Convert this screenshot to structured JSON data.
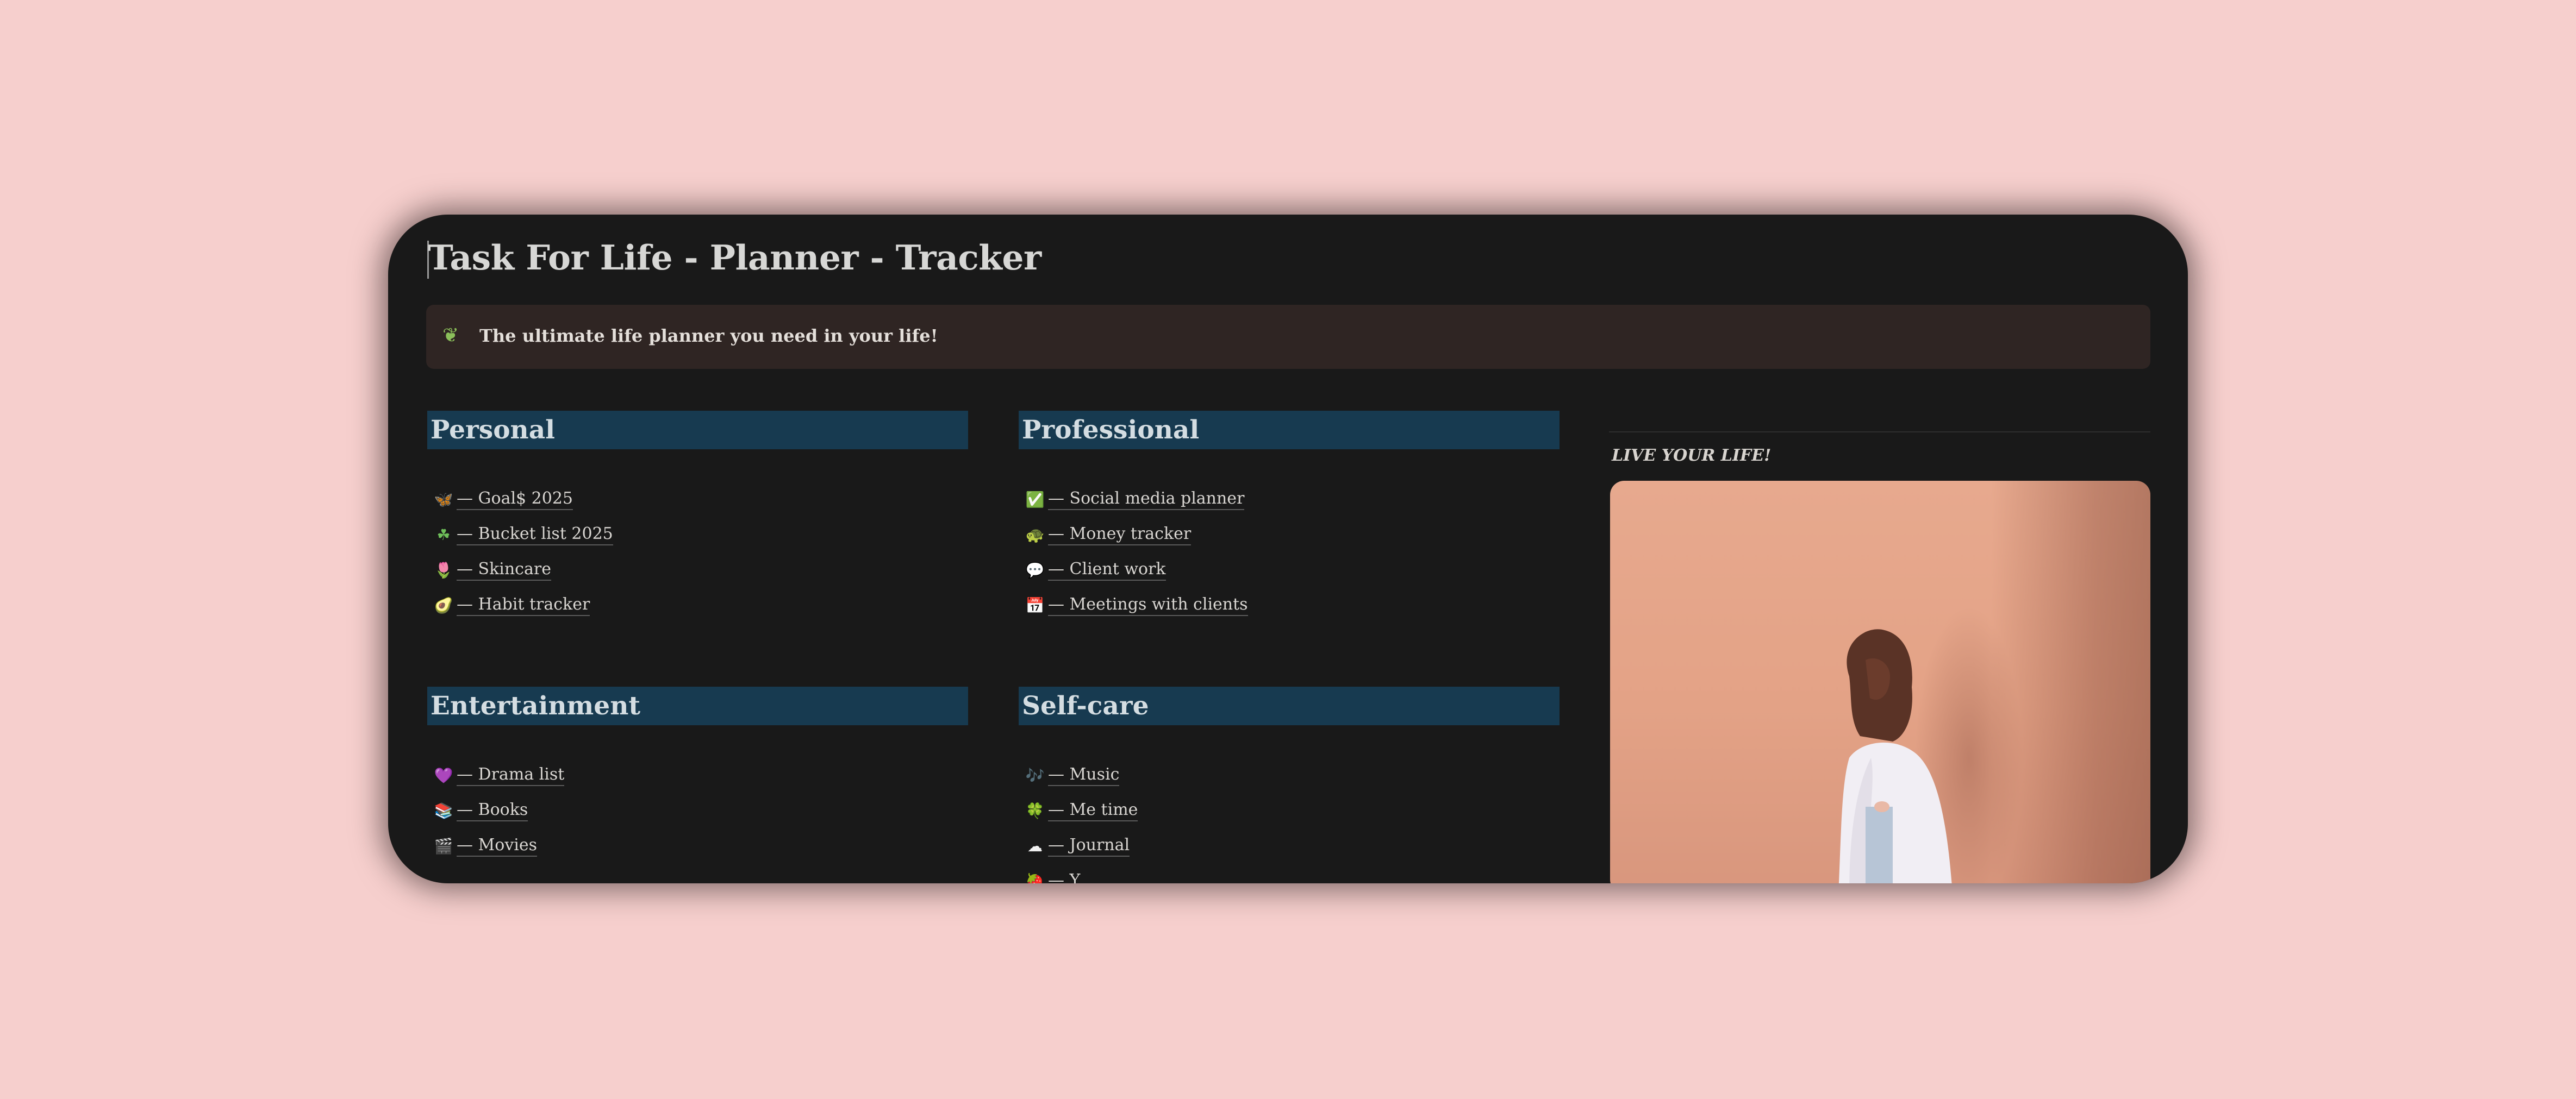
{
  "page": {
    "title": "Task For Life - Planner - Tracker",
    "callout": {
      "icon": "seedling-icon",
      "text": "The ultimate life planner you need in your life!"
    }
  },
  "sections": {
    "personal": {
      "heading": "Personal",
      "items": [
        {
          "icon": "butterfly-icon",
          "glyph": "🦋",
          "label": "— Goal$ 2025"
        },
        {
          "icon": "shamrock-icon",
          "glyph": "☘",
          "label": "— Bucket list 2025"
        },
        {
          "icon": "flower-icon",
          "glyph": "🌷",
          "label": "— Skincare"
        },
        {
          "icon": "avocado-icon",
          "glyph": "🥑",
          "label": "— Habit tracker"
        }
      ]
    },
    "professional": {
      "heading": "Professional",
      "items": [
        {
          "icon": "check-box-icon",
          "glyph": "✅",
          "label": "— Social media planner"
        },
        {
          "icon": "turtle-icon",
          "glyph": "🐢",
          "label": "— Money tracker"
        },
        {
          "icon": "speech-bubble-icon",
          "glyph": "💬",
          "label": "— Client work"
        },
        {
          "icon": "calendar-icon",
          "glyph": "📅",
          "label": "— Meetings with clients"
        }
      ]
    },
    "entertainment": {
      "heading": "Entertainment",
      "items": [
        {
          "icon": "purple-heart-icon",
          "glyph": "💜",
          "label": "— Drama list"
        },
        {
          "icon": "books-icon",
          "glyph": "📚",
          "label": "— Books"
        },
        {
          "icon": "clapper-board-icon",
          "glyph": "🎬",
          "label": "— Movies"
        }
      ]
    },
    "selfcare": {
      "heading": "Self-care",
      "items": [
        {
          "icon": "music-notes-icon",
          "glyph": "🎶",
          "label": "— Music"
        },
        {
          "icon": "four-leaf-clover-icon",
          "glyph": "🍀",
          "label": "— Me time"
        },
        {
          "icon": "cloud-icon",
          "glyph": "☁",
          "label": "— Journal"
        },
        {
          "icon": "partial-icon",
          "glyph": "🍓",
          "label": "— Y..."
        }
      ]
    }
  },
  "sidebar": {
    "quote": "LIVE YOUR LIFE!",
    "image": "woman-against-peach-wall-photo"
  },
  "colors": {
    "page_background": "#f6cfcd",
    "window_background": "#191919",
    "callout_background": "#2f2523",
    "heading_background": "#173a50",
    "photo_wall": "#e3a286"
  }
}
